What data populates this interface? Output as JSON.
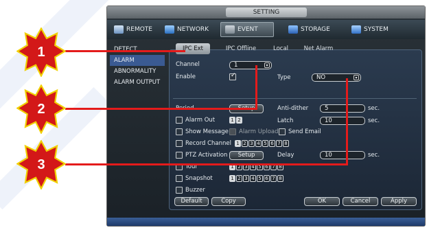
{
  "window": {
    "title": "SETTING"
  },
  "nav": [
    {
      "label": "REMOTE",
      "icon": "remote-icon"
    },
    {
      "label": "NETWORK",
      "icon": "network-icon"
    },
    {
      "label": "EVENT",
      "icon": "event-icon"
    },
    {
      "label": "STORAGE",
      "icon": "storage-icon"
    },
    {
      "label": "SYSTEM",
      "icon": "system-icon"
    }
  ],
  "sidebar": {
    "items": [
      {
        "label": "DETECT"
      },
      {
        "label": "ALARM"
      },
      {
        "label": "ABNORMALITY"
      },
      {
        "label": "ALARM OUTPUT"
      }
    ]
  },
  "subtabs": [
    {
      "label": "IPC Ext"
    },
    {
      "label": "IPC Offline"
    },
    {
      "label": "Local"
    },
    {
      "label": "Net Alarm"
    }
  ],
  "form": {
    "channel_label": "Channel",
    "channel_value": "1",
    "enable_label": "Enable",
    "type_label": "Type",
    "type_value": "NO",
    "period_label": "Period",
    "setup_label": "Setup",
    "antidither_label": "Anti-dither",
    "antidither_value": "5",
    "sec_label": "sec.",
    "alarm_out_label": "Alarm Out",
    "latch_label": "Latch",
    "latch_value": "10",
    "show_message_label": "Show Message",
    "alarm_upload_label": "Alarm Upload",
    "send_email_label": "Send Email",
    "record_channel_label": "Record Channel",
    "ptz_label": "PTZ Activation",
    "delay_label": "Delay",
    "delay_value": "10",
    "tour_label": "Tour",
    "snapshot_label": "Snapshot",
    "buzzer_label": "Buzzer",
    "alarm_out_nums": [
      "1",
      "2"
    ],
    "channel_nums": [
      "1",
      "2",
      "3",
      "4",
      "5",
      "6",
      "7",
      "8"
    ]
  },
  "buttons": {
    "default": "Default",
    "copy": "Copy",
    "ok": "OK",
    "cancel": "Cancel",
    "apply": "Apply"
  },
  "callouts": [
    "1",
    "2",
    "3"
  ],
  "colors": {
    "callout_red": "#e41b1b",
    "callout_fill": "#d31818",
    "active_nav": "#3a5a92"
  }
}
